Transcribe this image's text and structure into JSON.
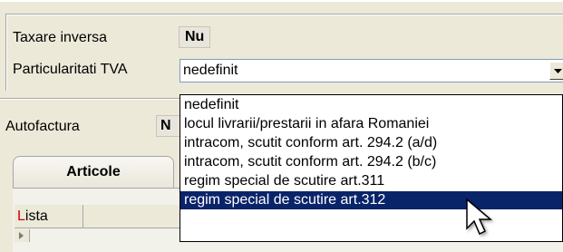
{
  "form": {
    "taxare_inversa": {
      "label": "Taxare inversa",
      "value": "Nu"
    },
    "particularitati_tva": {
      "label": "Particularitati TVA",
      "value": "nedefinit",
      "options": [
        "nedefinit",
        "locul livrarii/prestarii in afara Romaniei",
        "intracom, scutit conform art. 294.2 (a/d)",
        "intracom, scutit conform art. 294.2 (b/c)",
        "regim special de scutire art.311",
        "regim special de scutire art.312"
      ],
      "highlighted_option": "regim special de scutire art.312"
    },
    "autofactura": {
      "label": "Autofactura",
      "value_partial": "N"
    }
  },
  "tabs": {
    "articole": "Articole"
  },
  "grid": {
    "column_first_letter": "L",
    "column_rest": "ista"
  },
  "colors": {
    "selection": "#0a246a",
    "accent_red": "#d00000"
  }
}
